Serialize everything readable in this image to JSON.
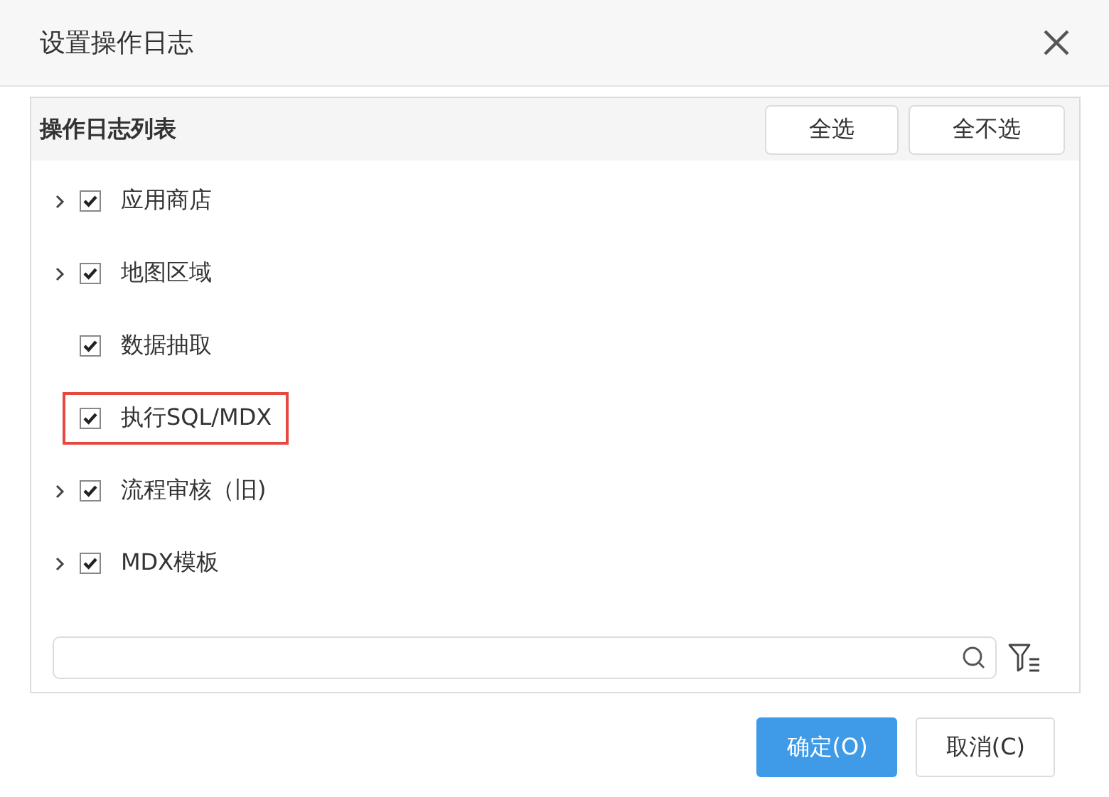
{
  "window": {
    "title": "设置操作日志"
  },
  "panel": {
    "title": "操作日志列表",
    "buttons": [
      "全选",
      "全不选"
    ],
    "items": [
      {
        "label": "应用商店",
        "expandable": true,
        "checked": true,
        "highlighted": false
      },
      {
        "label": "地图区域",
        "expandable": true,
        "checked": true,
        "highlighted": false
      },
      {
        "label": "数据抽取",
        "expandable": false,
        "checked": true,
        "highlighted": false
      },
      {
        "label": "执行SQL/MDX",
        "expandable": false,
        "checked": true,
        "highlighted": true
      },
      {
        "label": "流程审核（旧)",
        "expandable": true,
        "checked": true,
        "highlighted": false
      },
      {
        "label": "MDX模板",
        "expandable": true,
        "checked": true,
        "highlighted": false
      }
    ]
  },
  "footer": {
    "buttons": [
      {
        "label": "确定(O)",
        "kind": "primary"
      },
      {
        "label": "取消(C)",
        "kind": "secondary"
      }
    ]
  }
}
